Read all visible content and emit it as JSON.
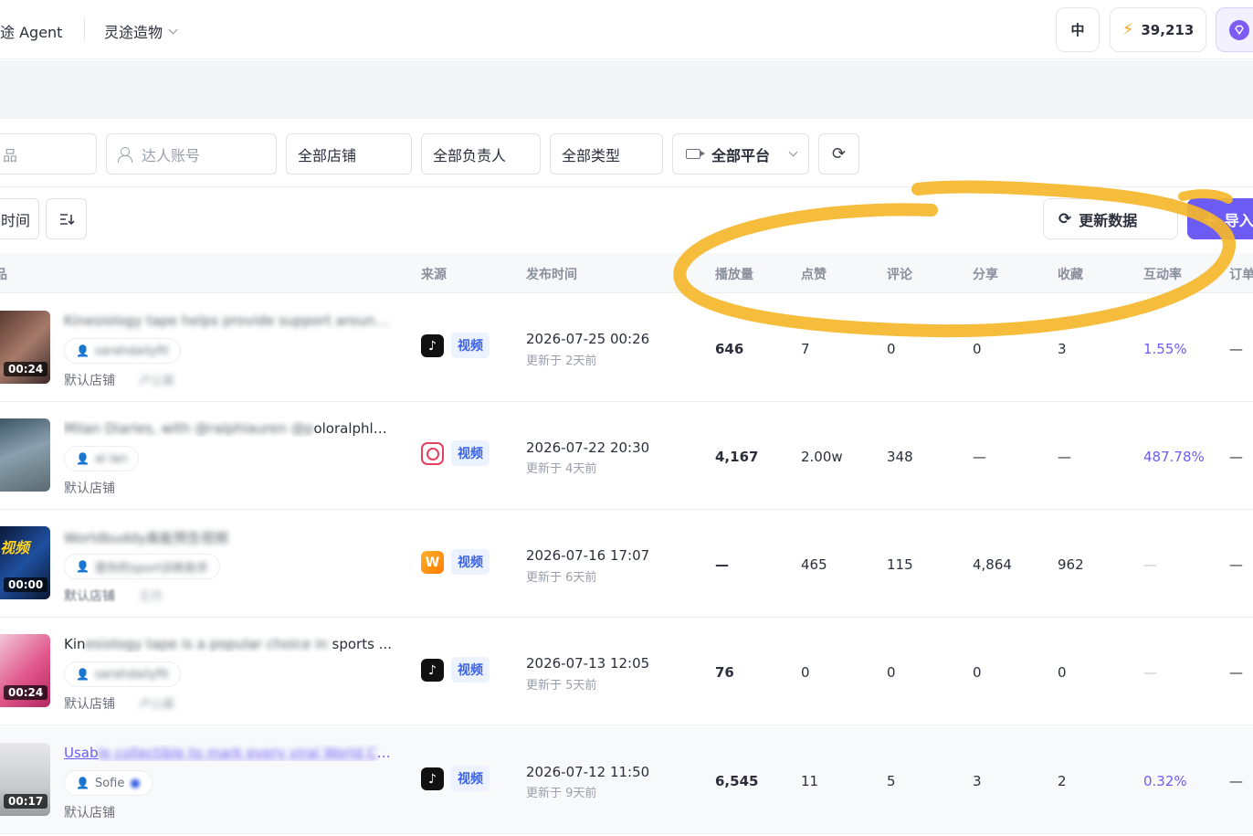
{
  "topbar": {
    "brand": "途 Agent",
    "workspace": "灵途造物",
    "lang": "中",
    "credits": "39,213"
  },
  "filters": {
    "product_partial": "品",
    "account_placeholder": "达人账号",
    "shop": "全部店铺",
    "owner": "全部负责人",
    "type": "全部类型",
    "platform": "全部平台"
  },
  "controls": {
    "time_partial": "时间",
    "update_label": "更新数据",
    "import_label": "导入"
  },
  "table": {
    "headers": {
      "source": "来源",
      "publish_time": "发布时间",
      "plays": "播放量",
      "likes": "点赞",
      "comments": "评论",
      "shares": "分享",
      "favorites": "收藏",
      "engagement": "互动率",
      "orders": "订单"
    },
    "rows": [
      {
        "duration": "00:24",
        "title": "Kinesiology tape helps provide support around...",
        "account": "sarahdailyfit",
        "shop": "默认店铺",
        "shop_extra": "卢公募",
        "platform": "tiktok",
        "media_type": "视频",
        "publish_time": "2026-07-25 00:26",
        "updated": "更新于 2天前",
        "plays": "646",
        "likes": "7",
        "comments": "0",
        "shares": "0",
        "favorites": "3",
        "engagement": "1.55%",
        "orders": "—"
      },
      {
        "duration": "",
        "title": "Milan Diaries, with @ralphlauren @poloralphla...",
        "account": "al lan",
        "shop": "默认店铺",
        "shop_extra": "",
        "platform": "instagram",
        "media_type": "视频",
        "publish_time": "2026-07-22 20:30",
        "updated": "更新于 4天前",
        "plays": "4,167",
        "likes": "2.00w",
        "comments": "348",
        "shares": "—",
        "favorites": "—",
        "engagement": "487.78%",
        "orders": "—"
      },
      {
        "duration": "00:00",
        "title": "Worldbuddy高能预告视频",
        "account": "是你的sport训练助手",
        "shop": "默认店铺",
        "shop_extra": "王丹",
        "platform": "worldbuddy",
        "media_type": "视频",
        "publish_time": "2026-07-16 17:07",
        "updated": "更新于 6天前",
        "plays": "—",
        "likes": "465",
        "comments": "115",
        "shares": "4,864",
        "favorites": "962",
        "engagement": "—",
        "orders": "—"
      },
      {
        "duration": "00:24",
        "title": "Kinesiology tape is a popular choice in sports ...",
        "account": "sarahdailyfit",
        "shop": "默认店铺",
        "shop_extra": "卢公募",
        "platform": "tiktok",
        "media_type": "视频",
        "publish_time": "2026-07-13 12:05",
        "updated": "更新于 5天前",
        "plays": "76",
        "likes": "0",
        "comments": "0",
        "shares": "0",
        "favorites": "0",
        "engagement": "—",
        "orders": "—"
      },
      {
        "duration": "00:17",
        "title": "Usable collectible to mark every viral World Cu...",
        "account": "Sofie",
        "shop": "默认店铺",
        "shop_extra": "",
        "platform": "tiktok",
        "media_type": "视频",
        "publish_time": "2026-07-12 11:50",
        "updated": "更新于 9天前",
        "plays": "6,545",
        "likes": "11",
        "comments": "5",
        "shares": "3",
        "favorites": "2",
        "engagement": "0.32%",
        "orders": "—"
      }
    ]
  },
  "colors": {
    "accent": "#6c5cf5",
    "highlight": "#f5b62a",
    "tag_blue": "#3b63e6"
  }
}
